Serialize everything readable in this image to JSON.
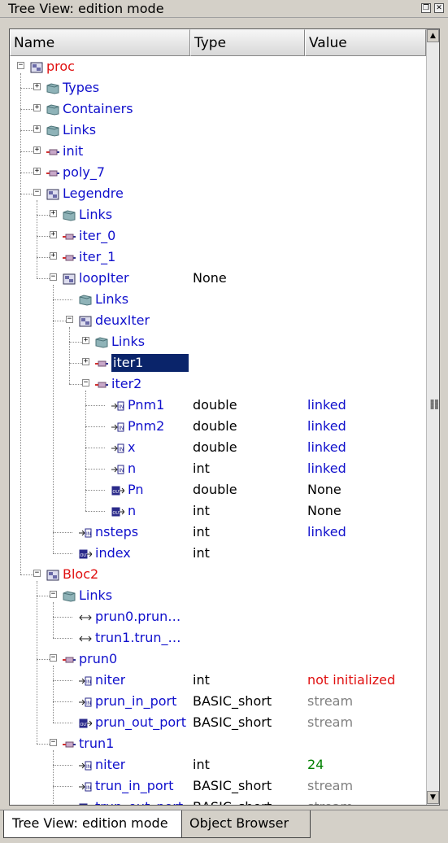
{
  "window": {
    "title": "Tree View: edition mode"
  },
  "columns": {
    "name": "Name",
    "type": "Type",
    "value": "Value"
  },
  "tabs": [
    "Tree View: edition mode",
    "Object Browser"
  ],
  "colors": {
    "selection": "#0a246a",
    "link_text": "#1010cc",
    "error_text": "#e01010",
    "ok_text": "#008000",
    "muted_text": "#808080"
  },
  "rows": [
    {
      "label": "proc",
      "depth": 0,
      "icon": "proc-node-icon",
      "exp": "-",
      "color": "red",
      "type": "",
      "value": "",
      "vcolor": ""
    },
    {
      "label": "Types",
      "depth": 1,
      "icon": "folder-icon",
      "exp": "+",
      "color": "blue",
      "type": "",
      "value": "",
      "vcolor": ""
    },
    {
      "label": "Containers",
      "depth": 1,
      "icon": "folder-icon",
      "exp": "+",
      "color": "blue",
      "type": "",
      "value": "",
      "vcolor": ""
    },
    {
      "label": "Links",
      "depth": 1,
      "icon": "folder-icon",
      "exp": "+",
      "color": "blue",
      "type": "",
      "value": "",
      "vcolor": ""
    },
    {
      "label": "init",
      "depth": 1,
      "icon": "node-icon",
      "exp": "+",
      "color": "blue",
      "type": "",
      "value": "",
      "vcolor": ""
    },
    {
      "label": "poly_7",
      "depth": 1,
      "icon": "node-icon",
      "exp": "+",
      "color": "blue",
      "type": "",
      "value": "",
      "vcolor": ""
    },
    {
      "label": "Legendre",
      "depth": 1,
      "icon": "block-node-icon",
      "exp": "-",
      "color": "blue",
      "type": "",
      "value": "",
      "vcolor": ""
    },
    {
      "label": "Links",
      "depth": 2,
      "icon": "folder-icon",
      "exp": "+",
      "color": "blue",
      "type": "",
      "value": "",
      "vcolor": ""
    },
    {
      "label": "iter_0",
      "depth": 2,
      "icon": "node-icon",
      "exp": "+",
      "color": "blue",
      "type": "",
      "value": "",
      "vcolor": ""
    },
    {
      "label": "iter_1",
      "depth": 2,
      "icon": "node-icon",
      "exp": "+",
      "color": "blue",
      "type": "",
      "value": "",
      "vcolor": ""
    },
    {
      "label": "loopIter",
      "depth": 2,
      "icon": "block-node-icon",
      "exp": "-",
      "color": "blue",
      "type": "None",
      "value": "",
      "vcolor": ""
    },
    {
      "label": "Links",
      "depth": 3,
      "icon": "folder-icon",
      "exp": "",
      "color": "blue",
      "type": "",
      "value": "",
      "vcolor": ""
    },
    {
      "label": "deuxIter",
      "depth": 3,
      "icon": "block-node-icon",
      "exp": "-",
      "color": "blue",
      "type": "",
      "value": "",
      "vcolor": ""
    },
    {
      "label": "Links",
      "depth": 4,
      "icon": "folder-icon",
      "exp": "+",
      "color": "blue",
      "type": "",
      "value": "",
      "vcolor": ""
    },
    {
      "label": "iter1",
      "depth": 4,
      "icon": "node-icon",
      "exp": "+",
      "color": "blue",
      "type": "",
      "value": "",
      "vcolor": "",
      "selected": true
    },
    {
      "label": "iter2",
      "depth": 4,
      "icon": "node-icon",
      "exp": "-",
      "color": "blue",
      "type": "",
      "value": "",
      "vcolor": ""
    },
    {
      "label": "Pnm1",
      "depth": 5,
      "icon": "in-port-icon",
      "exp": "",
      "color": "blue",
      "type": "double",
      "value": "linked",
      "vcolor": "blue"
    },
    {
      "label": "Pnm2",
      "depth": 5,
      "icon": "in-port-icon",
      "exp": "",
      "color": "blue",
      "type": "double",
      "value": "linked",
      "vcolor": "blue"
    },
    {
      "label": "x",
      "depth": 5,
      "icon": "in-port-icon",
      "exp": "",
      "color": "blue",
      "type": "double",
      "value": "linked",
      "vcolor": "blue"
    },
    {
      "label": "n",
      "depth": 5,
      "icon": "in-port-icon",
      "exp": "",
      "color": "blue",
      "type": "int",
      "value": "linked",
      "vcolor": "blue"
    },
    {
      "label": "Pn",
      "depth": 5,
      "icon": "out-port-icon",
      "exp": "",
      "color": "blue",
      "type": "double",
      "value": "None",
      "vcolor": "black"
    },
    {
      "label": "n",
      "depth": 5,
      "icon": "out-port-icon",
      "exp": "",
      "color": "blue",
      "type": "int",
      "value": "None",
      "vcolor": "black"
    },
    {
      "label": "nsteps",
      "depth": 3,
      "icon": "in-port-icon",
      "exp": "",
      "color": "blue",
      "type": "int",
      "value": "linked",
      "vcolor": "blue"
    },
    {
      "label": "index",
      "depth": 3,
      "icon": "out-port-icon",
      "exp": "",
      "color": "blue",
      "type": "int",
      "value": "",
      "vcolor": ""
    },
    {
      "label": "Bloc2",
      "depth": 1,
      "icon": "block-node-icon",
      "exp": "-",
      "color": "red",
      "type": "",
      "value": "",
      "vcolor": ""
    },
    {
      "label": "Links",
      "depth": 2,
      "icon": "folder-icon",
      "exp": "-",
      "color": "blue",
      "type": "",
      "value": "",
      "vcolor": ""
    },
    {
      "label": "prun0.prun…",
      "depth": 3,
      "icon": "link-arrow-icon",
      "exp": "",
      "color": "blue",
      "type": "",
      "value": "",
      "vcolor": ""
    },
    {
      "label": "trun1.trun_…",
      "depth": 3,
      "icon": "link-arrow-icon",
      "exp": "",
      "color": "blue",
      "type": "",
      "value": "",
      "vcolor": ""
    },
    {
      "label": "prun0",
      "depth": 2,
      "icon": "node-icon",
      "exp": "-",
      "color": "blue",
      "type": "",
      "value": "",
      "vcolor": ""
    },
    {
      "label": "niter",
      "depth": 3,
      "icon": "in-port-icon",
      "exp": "",
      "color": "blue",
      "type": "int",
      "value": "not initialized",
      "vcolor": "red"
    },
    {
      "label": "prun_in_port",
      "depth": 3,
      "icon": "in-port-icon",
      "exp": "",
      "color": "blue",
      "type": "BASIC_short",
      "value": "stream",
      "vcolor": "gray"
    },
    {
      "label": "prun_out_port",
      "depth": 3,
      "icon": "out-port-icon",
      "exp": "",
      "color": "blue",
      "type": "BASIC_short",
      "value": "stream",
      "vcolor": "gray"
    },
    {
      "label": "trun1",
      "depth": 2,
      "icon": "node-icon",
      "exp": "-",
      "color": "blue",
      "type": "",
      "value": "",
      "vcolor": ""
    },
    {
      "label": "niter",
      "depth": 3,
      "icon": "in-port-icon",
      "exp": "",
      "color": "blue",
      "type": "int",
      "value": "24",
      "vcolor": "green"
    },
    {
      "label": "trun_in_port",
      "depth": 3,
      "icon": "in-port-icon",
      "exp": "",
      "color": "blue",
      "type": "BASIC_short",
      "value": "stream",
      "vcolor": "gray"
    },
    {
      "label": "trun_out_port",
      "depth": 3,
      "icon": "out-port-icon",
      "exp": "",
      "color": "blue",
      "type": "BASIC_short",
      "value": "stream",
      "vcolor": "gray"
    }
  ]
}
